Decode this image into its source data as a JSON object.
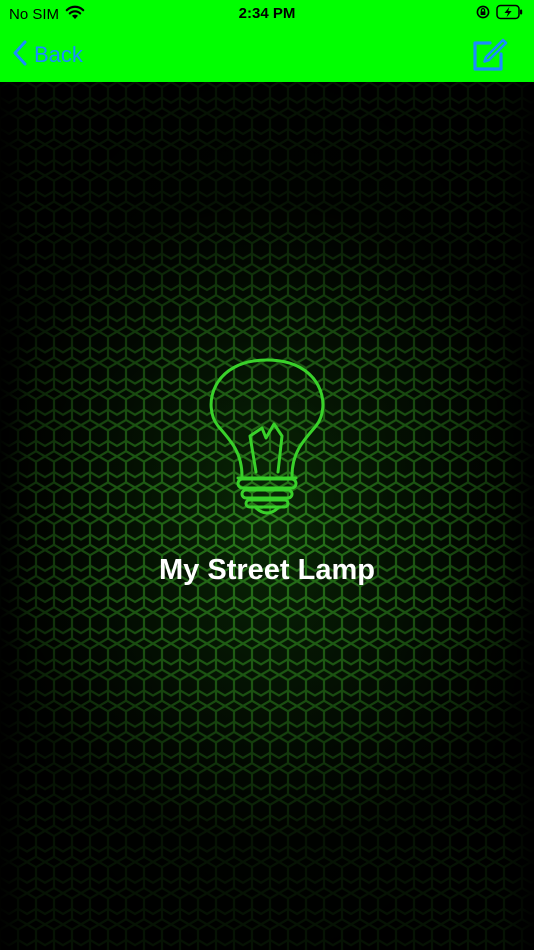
{
  "status_bar": {
    "carrier": "No SIM",
    "time": "2:34 PM",
    "wifi_icon": "wifi-icon",
    "lock_icon": "orientation-lock-icon",
    "battery_icon": "battery-charging-icon"
  },
  "nav": {
    "back_label": "Back",
    "back_icon": "chevron-left-icon",
    "edit_icon": "compose-icon",
    "accent_color": "#00ff00",
    "tint_color": "#0a84ff"
  },
  "main": {
    "device_name": "My Street Lamp",
    "device_icon": "light-bulb-icon",
    "glow_color": "#39d12a"
  }
}
